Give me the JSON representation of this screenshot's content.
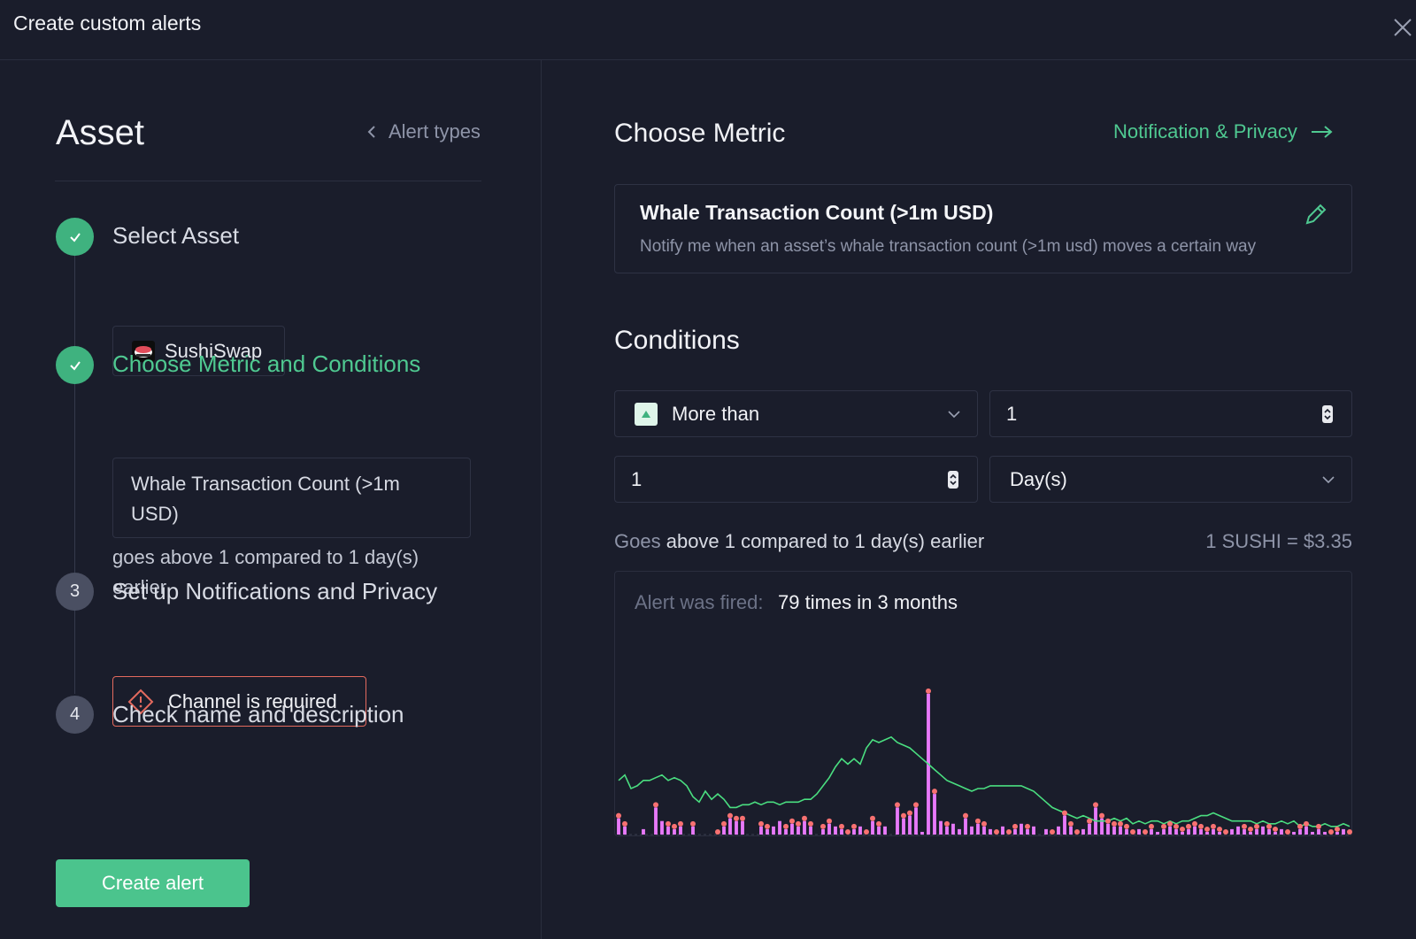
{
  "header": {
    "title": "Create custom alerts",
    "close_icon": "close-icon"
  },
  "left": {
    "title": "Asset",
    "alert_types_label": "Alert types",
    "steps": [
      {
        "number": "1",
        "status": "done",
        "label": "Select Asset"
      },
      {
        "number": "2",
        "status": "done",
        "label": "Choose Metric and Conditions"
      },
      {
        "number": "3",
        "status": "pending",
        "label": "Set up Notifications and Privacy"
      },
      {
        "number": "4",
        "status": "pending",
        "label": "Check name and description"
      }
    ],
    "asset_name": "SushiSwap",
    "metric_name": "Whale Transaction Count (>1m USD)",
    "condition_text": "goes above 1 compared to 1 day(s) earlier",
    "channel_error": "Channel is required",
    "create_button": "Create alert"
  },
  "right": {
    "title": "Choose Metric",
    "notif_link": "Notification & Privacy",
    "metric_title": "Whale Transaction Count (>1m USD)",
    "metric_desc": "Notify me when an asset’s whale transaction count (>1m usd) moves a certain way",
    "conditions_title": "Conditions",
    "operator": "More than",
    "threshold": "1",
    "period_value": "1",
    "period_unit": "Day(s)",
    "summary_prefix": "Goes",
    "summary_bold": "above 1 compared to 1 day(s) earlier",
    "price": "1 SUSHI = $3.35",
    "fired_label": "Alert was fired:",
    "fired_value": "79 times in 3 months"
  },
  "colors": {
    "accent": "#4bc48d",
    "error": "#e46a5e",
    "bar": "#e879f9",
    "dot": "#f87171",
    "line": "#4ade80",
    "background": "#1a1d2b"
  },
  "chart_data": {
    "type": "bar",
    "series": [
      {
        "values": [
          6,
          3,
          0,
          0,
          2,
          0,
          10,
          5,
          3,
          2,
          3,
          0,
          3,
          0,
          0,
          0,
          0,
          3,
          6,
          5,
          5,
          0,
          0,
          3,
          2,
          3,
          5,
          2,
          4,
          3,
          5,
          3,
          0,
          2,
          4,
          3,
          2,
          0,
          2,
          3,
          0,
          5,
          3,
          3,
          0,
          10,
          6,
          7,
          10,
          1,
          52,
          15,
          5,
          3,
          4,
          2,
          6,
          3,
          4,
          3,
          2,
          0,
          3,
          0,
          2,
          4,
          2,
          3,
          0,
          2,
          0,
          3,
          7,
          3,
          0,
          2,
          4,
          10,
          6,
          4,
          3,
          3,
          2,
          0,
          2,
          0,
          2,
          1,
          2,
          3,
          2,
          1,
          2,
          3,
          2,
          1,
          2,
          1,
          0,
          2,
          3,
          2,
          1,
          2,
          3,
          2,
          1,
          2,
          0,
          1,
          2,
          3,
          1,
          2,
          1,
          0,
          1,
          2,
          0
        ]
      },
      {
        "values": [
          20,
          22,
          17,
          18,
          20,
          20,
          21,
          22,
          20,
          21,
          20,
          18,
          14,
          12,
          16,
          13,
          15,
          13,
          10,
          10,
          11,
          11,
          12,
          11,
          12,
          12,
          11,
          12,
          12,
          12,
          13,
          13,
          15,
          18,
          21,
          25,
          28,
          26,
          28,
          26,
          32,
          35,
          34,
          35,
          36,
          34,
          33,
          32,
          30,
          28,
          26,
          24,
          22,
          20,
          19,
          18,
          17,
          16,
          17,
          17,
          18,
          18,
          18,
          18,
          18,
          18,
          17,
          16,
          14,
          12,
          10,
          9,
          8,
          7,
          6,
          7,
          6,
          5,
          5,
          5,
          6,
          5,
          6,
          4,
          5,
          4,
          5,
          5,
          4,
          5,
          4,
          5,
          5,
          6,
          7,
          7,
          8,
          7,
          6,
          5,
          5,
          5,
          5,
          4,
          5,
          4,
          4,
          5,
          4,
          5,
          3,
          4,
          3,
          3,
          4,
          3,
          3,
          4,
          3
        ]
      }
    ],
    "fired_points": [
      0,
      1,
      6,
      8,
      9,
      10,
      12,
      16,
      17,
      18,
      19,
      20,
      23,
      24,
      27,
      28,
      29,
      30,
      31,
      33,
      34,
      36,
      37,
      38,
      40,
      41,
      42,
      45,
      46,
      47,
      48,
      50,
      51,
      53,
      56,
      58,
      59,
      61,
      63,
      64,
      66,
      70,
      72,
      73,
      74,
      76,
      77,
      78,
      79,
      80,
      81,
      82,
      83,
      85,
      86,
      88,
      89,
      90,
      91,
      92,
      93,
      94,
      95,
      96,
      97,
      98,
      101,
      102,
      103,
      105,
      106,
      108,
      110,
      111,
      113,
      115,
      116,
      118,
      119
    ]
  }
}
